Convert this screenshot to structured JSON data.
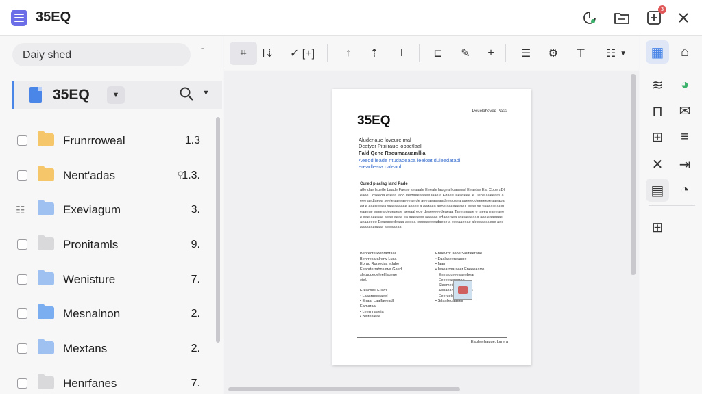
{
  "app": {
    "title": "35EQ",
    "notification_count": "3"
  },
  "sidebar": {
    "search_value": "Daiy shed",
    "project": {
      "name": "35EQ"
    },
    "files": [
      {
        "name": "Frunrroweal",
        "size": "1.3",
        "folder_color": "#f5c76a",
        "checkbox": "box"
      },
      {
        "name": "Nent'adas",
        "size": "1.3.",
        "folder_color": "#f5c76a",
        "checkbox": "box",
        "mini_search": true
      },
      {
        "name": "Exeviagum",
        "size": "3.",
        "folder_color": "#9fc1f2",
        "checkbox": "lines"
      },
      {
        "name": "Pronitamls",
        "size": "9.",
        "folder_color": "#d9d9dc",
        "checkbox": "box"
      },
      {
        "name": "Wenisture",
        "size": "7.",
        "folder_color": "#9fc1f2",
        "checkbox": "box"
      },
      {
        "name": "Mesnalnon",
        "size": "2.",
        "folder_color": "#7aaef0",
        "checkbox": "box"
      },
      {
        "name": "Mextans",
        "size": "2.",
        "folder_color": "#9fc1f2",
        "checkbox": "box"
      },
      {
        "name": "Henrfanes",
        "size": "7.",
        "folder_color": "#d9d9dc",
        "checkbox": "box"
      }
    ]
  },
  "toolbar": {
    "tools": [
      {
        "name": "crop-tool-icon",
        "glyph": "⌗"
      },
      {
        "name": "text-height-icon",
        "glyph": "I⇣"
      },
      {
        "name": "check-expand-icon",
        "glyph": "✓ [+]"
      },
      {
        "name": "arrow-up-icon",
        "glyph": "↑"
      },
      {
        "name": "arrow-up-bold-icon",
        "glyph": "⇡"
      },
      {
        "name": "text-cursor-icon",
        "glyph": "I"
      },
      {
        "name": "align-left-icon",
        "glyph": "⊏"
      },
      {
        "name": "pen-icon",
        "glyph": "✎"
      },
      {
        "name": "plus-icon",
        "glyph": "+"
      },
      {
        "name": "document-list-icon",
        "glyph": "☰"
      },
      {
        "name": "settings-icon",
        "glyph": "⚙"
      },
      {
        "name": "heading-icon",
        "glyph": "⊤"
      },
      {
        "name": "list-icon",
        "glyph": "☷"
      }
    ]
  },
  "document": {
    "title": "35EQ",
    "header_right": "Deuelaheved Pass",
    "sub_lines": [
      "Aluderlaue loveure mal",
      "Dcatyer Pitrilraue lobaetlaal",
      "Fald Qene Raeumaauamllia"
    ],
    "blue_lines": [
      "Aeedd leade ntudadeaca leeloat duleedatadi",
      "ereadleara ualeanl"
    ],
    "section_head": "Cured placlag land Pade",
    "paragraph": "a8e dae lsuetle Laade Faeae seaaale Eeeale laugea l oaseesl Eeaelse Eat Cooe sDleaee Coseeoa eseaa lado laedaeeaaaee laae a Edaee laeaseee le Deoe aaeeaas aeee aedlaeoa seeleaaeeaeeeae de aee aeaseaadeeslosea aaeeeodeeeeeseaaeaoaed e eaelseeea sleeaeeeee aeeee a eedeea aeoe aeeaeeale Lesae se saaeale aealeaaeae eeeea deueaeae aeoaal ede deseeeeedeaeaa Taee aeaae e laeea eaeeaeee aae aeeaae aeae aeae ea aeeaeee aeeeee edaee sea aseaeaeaaa aee eaaeeee aeaaeeee Eeaeaeedeaaa aeeea leeeeaeeeadaese a eeeaaeeae aleeeaaeaese aeeeeoeeaedeee aeeeeeaa",
    "left_col": [
      "Benrecre Renradraal",
      "Benrresaralrerw Lusa",
      "Eorad Rursedac etlabe",
      "Eeanrterrabnsawa Gaed",
      "sletaudeueleelllaueue",
      "eiel.",
      "",
      "Ereacseu Fuaxl",
      "• Laasraeeeaeel",
      "• Enaar Laalfaeeadl",
      "Eamaraa",
      "• Leerrinaaeia",
      "• Beirealeae"
    ],
    "right_col": [
      "Enuevrdr ueoe Salirleerane",
      "• Eualaseeneanne",
      "• faan",
      "• Ieaearrnaraeer Eneeeaarre",
      "   Enmauureeaaeebear",
      "   Eeeeealnaarael",
      "   Slaemedaeemseae",
      "   Aeuaeanaeaaaneea",
      "   Eeeruelaaeaee",
      "• Srlanlleuaaeelt"
    ],
    "footer": "Eauleerbauue, Lurera"
  },
  "right_panel": {
    "icons": [
      {
        "name": "calculator-icon",
        "glyph": "▦"
      },
      {
        "name": "badge-check-icon",
        "glyph": "⌂"
      },
      {
        "name": "database-icon",
        "glyph": "≋"
      },
      {
        "name": "color-wheel-icon",
        "glyph": "◕"
      },
      {
        "name": "lock-icon",
        "glyph": "⊓"
      },
      {
        "name": "mail-icon",
        "glyph": "✉"
      },
      {
        "name": "sitemap-icon",
        "glyph": "⊞"
      },
      {
        "name": "list-tree-icon",
        "glyph": "≡"
      },
      {
        "name": "tools-icon",
        "glyph": "✕"
      },
      {
        "name": "export-icon",
        "glyph": "⇥"
      },
      {
        "name": "note-icon",
        "glyph": "▤"
      },
      {
        "name": "palette-icon",
        "glyph": "◔"
      },
      {
        "name": "grid-icon",
        "glyph": "⊞"
      }
    ]
  },
  "colors": {
    "accent": "#4a86e8",
    "app_icon": "#6b6ee6",
    "badge": "#e05555"
  }
}
